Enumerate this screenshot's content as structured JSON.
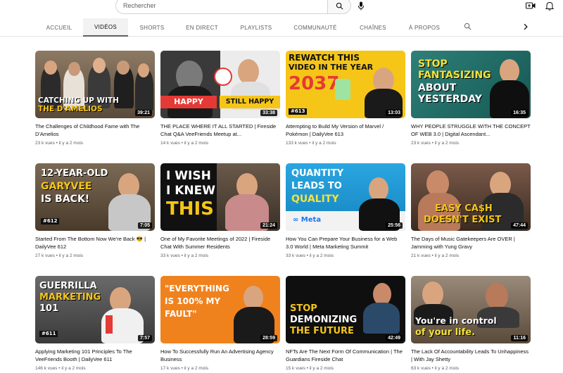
{
  "search": {
    "placeholder": "Rechercher"
  },
  "tabs": [
    {
      "label": "ACCUEIL"
    },
    {
      "label": "VIDÉOS"
    },
    {
      "label": "SHORTS"
    },
    {
      "label": "EN DIRECT"
    },
    {
      "label": "PLAYLISTS"
    },
    {
      "label": "COMMUNAUTÉ"
    },
    {
      "label": "CHAÎNES"
    },
    {
      "label": "À PROPOS"
    }
  ],
  "videos": [
    {
      "title": "The Challenges of Childhood Fame with The D'Amelios",
      "views": "23 k vues",
      "age": "il y a 2 mois",
      "duration": "39:21",
      "thumb_text": [
        "CATCHING UP WITH",
        "THE D'AMELIOS"
      ],
      "thumb_colors": {
        "bg": "#6b5b4a",
        "accent": "#f5c518"
      }
    },
    {
      "title": "THE PLACE WHERE IT ALL STARTED | Fireside Chat Q&A VeeFriends Meetup at...",
      "views": "14 k vues",
      "age": "il y a 2 mois",
      "duration": "33:38",
      "thumb_text": [
        "HAPPY",
        "STILL HAPPY"
      ],
      "thumb_colors": {
        "bg": "#3a3a3a",
        "accent": "#e53935"
      }
    },
    {
      "title": "Attempting to Build My Version of Marvel / Pokémon | DailyVee 613",
      "views": "133 k vues",
      "age": "il y a 2 mois",
      "duration": "13:03",
      "thumb_text": [
        "REWATCH THIS",
        "VIDEO IN THE YEAR",
        "2037"
      ],
      "thumb_badge": "#613",
      "thumb_colors": {
        "bg": "#f5c518",
        "accent": "#e53935"
      }
    },
    {
      "title": "WHY PEOPLE STRUGGLE WITH THE CONCEPT OF WEB 3.0 | Digital Ascendant...",
      "views": "23 k vues",
      "age": "il y a 2 mois",
      "duration": "16:35",
      "thumb_text": [
        "STOP",
        "FANTASIZING",
        "ABOUT",
        "YESTERDAY"
      ],
      "thumb_colors": {
        "bg": "#1f6b66",
        "accent": "#f5e23a"
      }
    },
    {
      "title": "Started From The Bottom Now We're Back 😎 | DailyVee 612",
      "views": "27 k vues",
      "age": "il y a 2 mois",
      "duration": "7:05",
      "thumb_text": [
        "12-YEAR-OLD",
        "GARYVEE",
        "IS BACK!"
      ],
      "thumb_badge": "#612",
      "thumb_colors": {
        "bg": "#5b4a3a",
        "accent": "#f5c518"
      }
    },
    {
      "title": "One of My Favorite Meetings of 2022 | Fireside Chat With Summer Residents",
      "views": "33 k vues",
      "age": "il y a 2 mois",
      "duration": "21:24",
      "thumb_text": [
        "I WISH",
        "I KNEW",
        "THIS"
      ],
      "thumb_colors": {
        "bg": "#111111",
        "accent": "#f5c518"
      }
    },
    {
      "title": "How You Can Prepare Your Business for a Web 3.0 World | Meta Marketing Summit",
      "views": "33 k vues",
      "age": "il y a 2 mois",
      "duration": "25:56",
      "thumb_text": [
        "QUANTITY",
        "LEADS TO",
        "QUALITY"
      ],
      "thumb_logo": "∞ Meta",
      "thumb_colors": {
        "bg": "#1e9ad6",
        "accent": "#f5e23a"
      }
    },
    {
      "title": "The Days of Music Gatekeepers Are OVER | Jamming with Yung Gravy",
      "views": "21 k vues",
      "age": "il y a 2 mois",
      "duration": "47:44",
      "thumb_text": [
        "EASY CA$H",
        "DOESN'T EXIST"
      ],
      "thumb_colors": {
        "bg": "#6b4b3a",
        "accent": "#f5c518"
      }
    },
    {
      "title": "Applying Marketing 101 Principles To The VeeFriends Booth | DailyVee 611",
      "views": "146 k vues",
      "age": "il y a 2 mois",
      "duration": "7:57",
      "thumb_text": [
        "GUERRILLA",
        "MARKETING",
        "101"
      ],
      "thumb_badge": "#611",
      "thumb_colors": {
        "bg": "#4a4a4a",
        "accent": "#f5c518"
      }
    },
    {
      "title": "How To Successfully Run An Advertising Agency Business",
      "views": "17 k vues",
      "age": "il y a 2 mois",
      "duration": "28:59",
      "thumb_text": [
        "\"EVERYTHING",
        "IS 100% MY",
        "FAULT\""
      ],
      "thumb_colors": {
        "bg": "#f0821e",
        "accent": "#ffffff"
      }
    },
    {
      "title": "NFTs Are The Next Form Of Communication | The Guardians Fireside Chat",
      "views": "15 k vues",
      "age": "il y a 2 mois",
      "duration": "42:49",
      "thumb_text": [
        "STOP",
        "DEMONIZING",
        "THE FUTURE"
      ],
      "thumb_colors": {
        "bg": "#0f0f0f",
        "accent": "#f5c518"
      }
    },
    {
      "title": "The Lack Of Accountability Leads To Unhappiness | With Jay Shetty",
      "views": "63 k vues",
      "age": "il y a 2 mois",
      "duration": "11:16",
      "thumb_text": [
        "You're in control",
        "of your life."
      ],
      "thumb_colors": {
        "bg": "#8a7a6a",
        "accent": "#f5e23a"
      }
    }
  ]
}
